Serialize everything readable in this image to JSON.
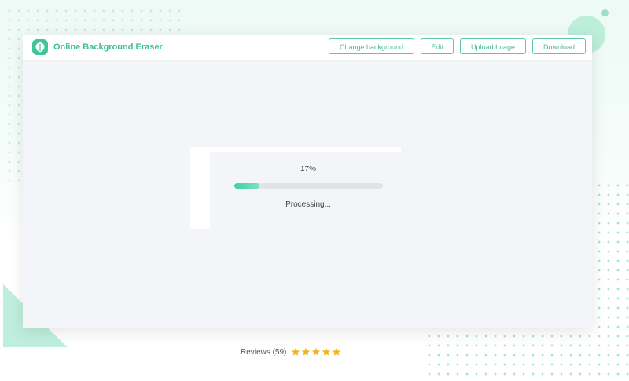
{
  "app": {
    "title": "Online Background Eraser",
    "logo_icon": "leaf-shield-icon",
    "accent_color": "#3fc596"
  },
  "toolbar": {
    "change_background_label": "Change background",
    "edit_label": "Edit",
    "upload_image_label": "Upload Image",
    "download_label": "Download"
  },
  "processing": {
    "percent_text": "17%",
    "progress_value": 0.17,
    "status_text": "Processing..."
  },
  "reviews": {
    "label": "Reviews (59)",
    "stars": 5,
    "star_color": "#f5b31b"
  }
}
